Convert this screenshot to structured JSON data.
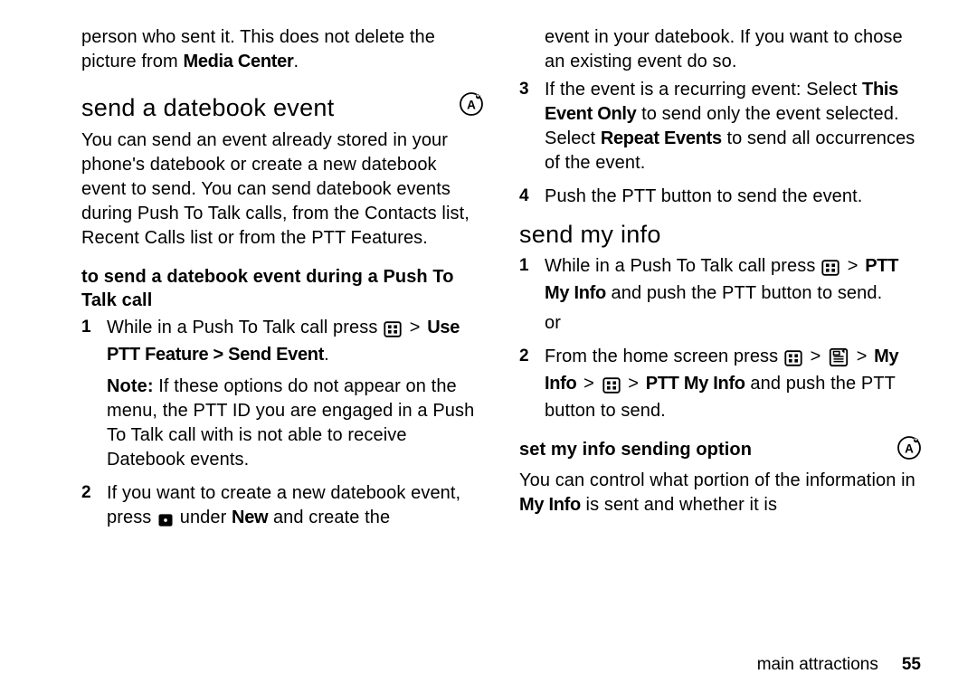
{
  "left": {
    "intro_para_a": "person who sent it. This does not delete the picture from ",
    "intro_para_bold": "Media Center",
    "intro_para_b": ".",
    "h2": "send a datebook event",
    "para1": "You can send an event already stored in your phone's datebook or create a new datebook event to send. You can send datebook events during Push To Talk calls, from the Contacts list, Recent Calls list or from the PTT Features.",
    "h3": "to send a datebook event during a Push To Talk call",
    "step1_a": "While in a Push To Talk call press ",
    "step1_b": "Use PTT Feature > Send Event",
    "step1_c": ".",
    "note_label": "Note:",
    "note_body": " If these options do not appear on the menu, the PTT ID you are engaged in a Push To Talk call with is not able to receive Datebook events.",
    "step2_a": "If you want to create a new datebook event, press ",
    "step2_b": " under ",
    "step2_new": "New",
    "step2_c": " and create the"
  },
  "right": {
    "cont_para": "event in your datebook. If you want to chose an existing event do so.",
    "step3_a": "If the event is a recurring event: Select ",
    "step3_b": "This Event Only",
    "step3_c": " to send only the event selected. Select ",
    "step3_d": "Repeat Events",
    "step3_e": " to send all occurrences of the event.",
    "step4": "Push the PTT button to send the event.",
    "h2": "send my info",
    "m_step1_a": "While in a Push To Talk call press ",
    "m_step1_b": "PTT My Info",
    "m_step1_c": " and push the PTT button to send.",
    "or": "or",
    "m_step2_a": "From the home screen press ",
    "m_step2_myinfo": "My Info",
    "m_step2_ptt": "PTT My Info",
    "m_step2_end": " and push the PTT button to send.",
    "h3": "set my info sending option",
    "set_para_a": "You can control what portion of the information in ",
    "set_para_b": "My Info",
    "set_para_c": " is sent and whether it is"
  },
  "footer": {
    "section": "main attractions",
    "page": "55"
  },
  "gt": ">"
}
